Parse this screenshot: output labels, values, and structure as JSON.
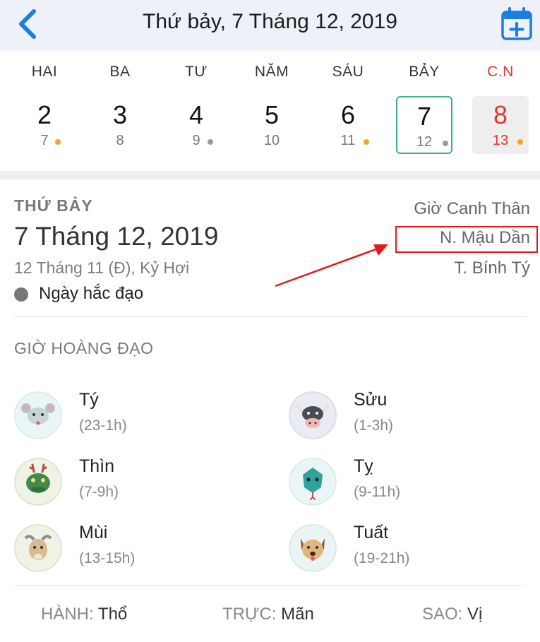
{
  "header": {
    "title": "Thứ bảy, 7 Tháng 12, 2019",
    "back_icon": "chevron-left-icon",
    "add_icon": "calendar-plus-icon",
    "accent_color": "#1a7fe0"
  },
  "week": [
    {
      "name": "HAI",
      "day": "2",
      "lunar": "7",
      "dot": "orange"
    },
    {
      "name": "BA",
      "day": "3",
      "lunar": "8",
      "dot": ""
    },
    {
      "name": "TƯ",
      "day": "4",
      "lunar": "9",
      "dot": "grey"
    },
    {
      "name": "NĂM",
      "day": "5",
      "lunar": "10",
      "dot": ""
    },
    {
      "name": "SÁU",
      "day": "6",
      "lunar": "11",
      "dot": "orange"
    },
    {
      "name": "BẢY",
      "day": "7",
      "lunar": "12",
      "dot": "grey",
      "selected": true
    },
    {
      "name": "C.N",
      "day": "8",
      "lunar": "13",
      "dot": "orange",
      "sunday": true
    }
  ],
  "day_info": {
    "weekday": "THỨ BẢY",
    "date": "7 Tháng 12, 2019",
    "lunar_date": "12 Tháng 11 (Đ), Kỷ Hợi",
    "day_type": "Ngày hắc đạo",
    "hour_canchi": "Giờ Canh Thân",
    "day_canchi": "N. Mậu Dần",
    "month_canchi": "T. Bính Tý"
  },
  "hours_section": {
    "title": "GIỜ HOÀNG ĐẠO",
    "items": [
      {
        "name": "Tý",
        "range": "(23-1h)",
        "icon": "rat-icon"
      },
      {
        "name": "Sửu",
        "range": "(1-3h)",
        "icon": "ox-icon"
      },
      {
        "name": "Thìn",
        "range": "(7-9h)",
        "icon": "dragon-icon"
      },
      {
        "name": "Tỵ",
        "range": "(9-11h)",
        "icon": "snake-icon"
      },
      {
        "name": "Mùi",
        "range": "(13-15h)",
        "icon": "goat-icon"
      },
      {
        "name": "Tuất",
        "range": "(19-21h)",
        "icon": "dog-icon"
      }
    ]
  },
  "footer": {
    "hanh_label": "HÀNH:",
    "hanh_value": "Thổ",
    "truc_label": "TRỰC:",
    "truc_value": "Mãn",
    "sao_label": "SAO:",
    "sao_value": "Vị"
  }
}
